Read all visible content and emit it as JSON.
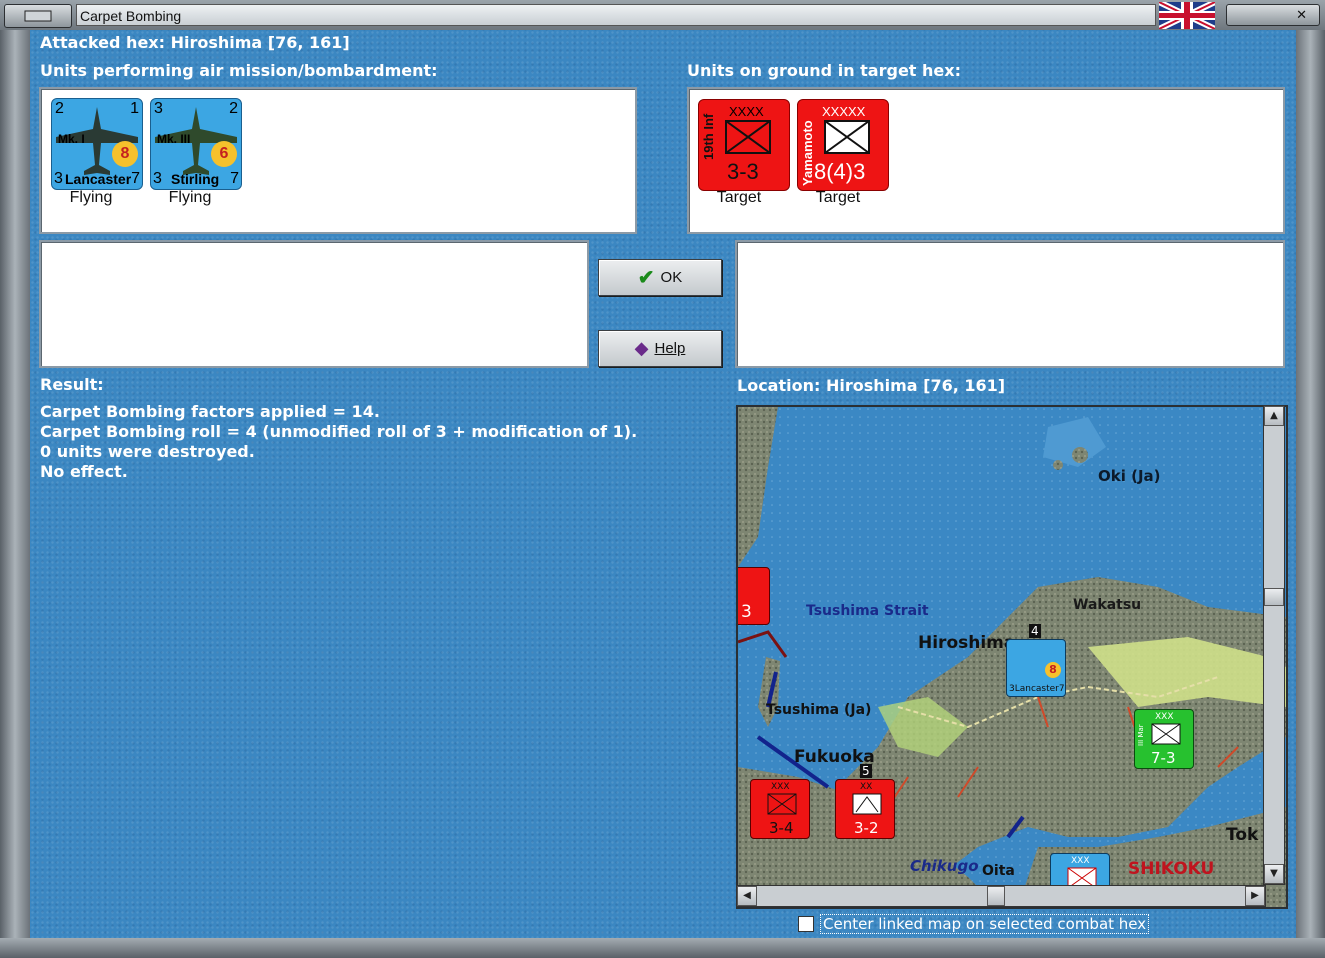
{
  "window": {
    "title": "Carpet Bombing"
  },
  "header": {
    "attacked_hex": "Attacked hex: Hiroshima  [76, 161]",
    "air_units_label": "Units performing air mission/bombardment:",
    "ground_units_label": "Units on ground in target hex:"
  },
  "air_units": [
    {
      "top_left": "2",
      "top_right": "1",
      "model": "Mk. I",
      "bottom_left": "3",
      "name": "Lancaster",
      "bottom_right": "7",
      "badge": "8",
      "status": "Flying"
    },
    {
      "top_left": "3",
      "top_right": "2",
      "model": "Mk. III",
      "bottom_left": "3",
      "name": "Stirling",
      "bottom_right": "7",
      "badge": "6",
      "status": "Flying"
    }
  ],
  "ground_units": [
    {
      "side_label": "19th Inf",
      "size": "XXXX",
      "strength": "3-3",
      "status": "Target"
    },
    {
      "side_label": "Yamamoto",
      "size": "XXXXX",
      "strength": "8(4)3",
      "status": "Target"
    }
  ],
  "buttons": {
    "ok": "OK",
    "help": "Help"
  },
  "result": {
    "label": "Result:",
    "lines": [
      "Carpet Bombing factors applied = 14.",
      "Carpet Bombing roll = 4 (unmodified roll of 3 + modification of 1).",
      "0 units were destroyed.",
      "No effect."
    ]
  },
  "location": {
    "label": "Location:  Hiroshima  [76, 161]"
  },
  "map": {
    "labels": {
      "oki": "Oki (Ja)",
      "wakatsu": "Wakatsu",
      "strait": "Tsushima Strait",
      "hiroshima": "Hiroshima",
      "tsushima": "Tsushima (Ja)",
      "fukuoka": "Fukuoka",
      "chikugo": "Chikugo",
      "oita": "Oita",
      "shikoku": "SHIKOKU",
      "tok": "Tok"
    },
    "counters": {
      "left_partial": "3",
      "stack_num": "4",
      "green_strength": "7-3",
      "red_a_strength": "3-4",
      "red_b_strength": "3-2",
      "red_b_stack": "5",
      "size_xxx": "XXX",
      "size_xx": "XX",
      "mini_badge": "8",
      "mini_name": "3Lancaster7",
      "green_side": "III Mar"
    }
  },
  "options": {
    "center_map": "Center linked map on selected combat hex",
    "center_map_checked": false
  },
  "colors": {
    "panel_blue": "#3b87c2",
    "air_unit": "#3ca6e3",
    "ground_unit": "#ee1414",
    "allied_green": "#27c12f"
  }
}
